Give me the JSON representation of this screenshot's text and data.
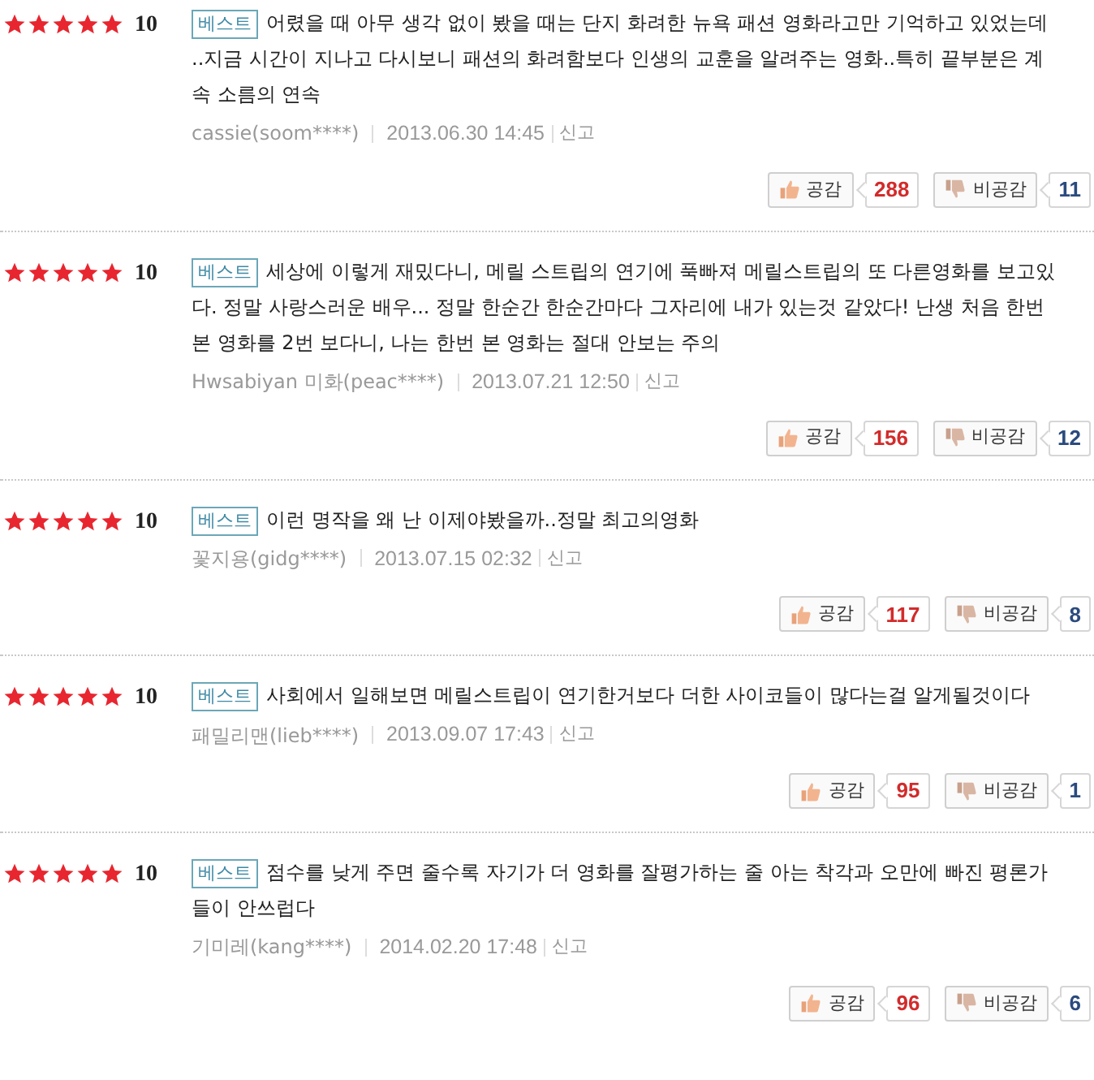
{
  "reviews": [
    {
      "stars": 5,
      "score": "10",
      "badge": "베스트",
      "text": "어렸을 때 아무 생각 없이 봤을 때는 단지 화려한 뉴욕 패션 영화라고만 기억하고 있었는데 ..지금 시간이 지나고 다시보니 패션의 화려함보다 인생의 교훈을 알려주는 영화..특히 끝부분은 계속 소름의 연속",
      "author": "cassie(soom****)",
      "date": "2013.06.30 14:45",
      "report": "신고",
      "like_label": "공감",
      "likes": "288",
      "dislike_label": "비공감",
      "dislikes": "11"
    },
    {
      "stars": 5,
      "score": "10",
      "badge": "베스트",
      "text": "세상에 이렇게 재밌다니, 메릴 스트립의 연기에 푹빠져 메릴스트립의 또 다른영화를 보고있다. 정말 사랑스러운 배우... 정말 한순간 한순간마다 그자리에 내가 있는것 같았다! 난생 처음 한번 본 영화를 2번 보다니, 나는 한번 본 영화는 절대 안보는 주의",
      "author": "Hwsabiyan 미화(peac****)",
      "date": "2013.07.21 12:50",
      "report": "신고",
      "like_label": "공감",
      "likes": "156",
      "dislike_label": "비공감",
      "dislikes": "12"
    },
    {
      "stars": 5,
      "score": "10",
      "badge": "베스트",
      "text": "이런 명작을 왜 난 이제야봤을까..정말 최고의영화",
      "author": "꽃지용(gidg****)",
      "date": "2013.07.15 02:32",
      "report": "신고",
      "like_label": "공감",
      "likes": "117",
      "dislike_label": "비공감",
      "dislikes": "8"
    },
    {
      "stars": 5,
      "score": "10",
      "badge": "베스트",
      "text": "사회에서 일해보면 메릴스트립이 연기한거보다 더한 사이코들이 많다는걸 알게될것이다",
      "author": "패밀리맨(lieb****)",
      "date": "2013.09.07 17:43",
      "report": "신고",
      "like_label": "공감",
      "likes": "95",
      "dislike_label": "비공감",
      "dislikes": "1"
    },
    {
      "stars": 5,
      "score": "10",
      "badge": "베스트",
      "text": "점수를 낮게 주면 줄수록 자기가 더 영화를 잘평가하는 줄 아는 착각과 오만에 빠진 평론가들이 안쓰럽다",
      "author": "기미레(kang****)",
      "date": "2014.02.20 17:48",
      "report": "신고",
      "like_label": "공감",
      "likes": "96",
      "dislike_label": "비공감",
      "dislikes": "6"
    }
  ]
}
